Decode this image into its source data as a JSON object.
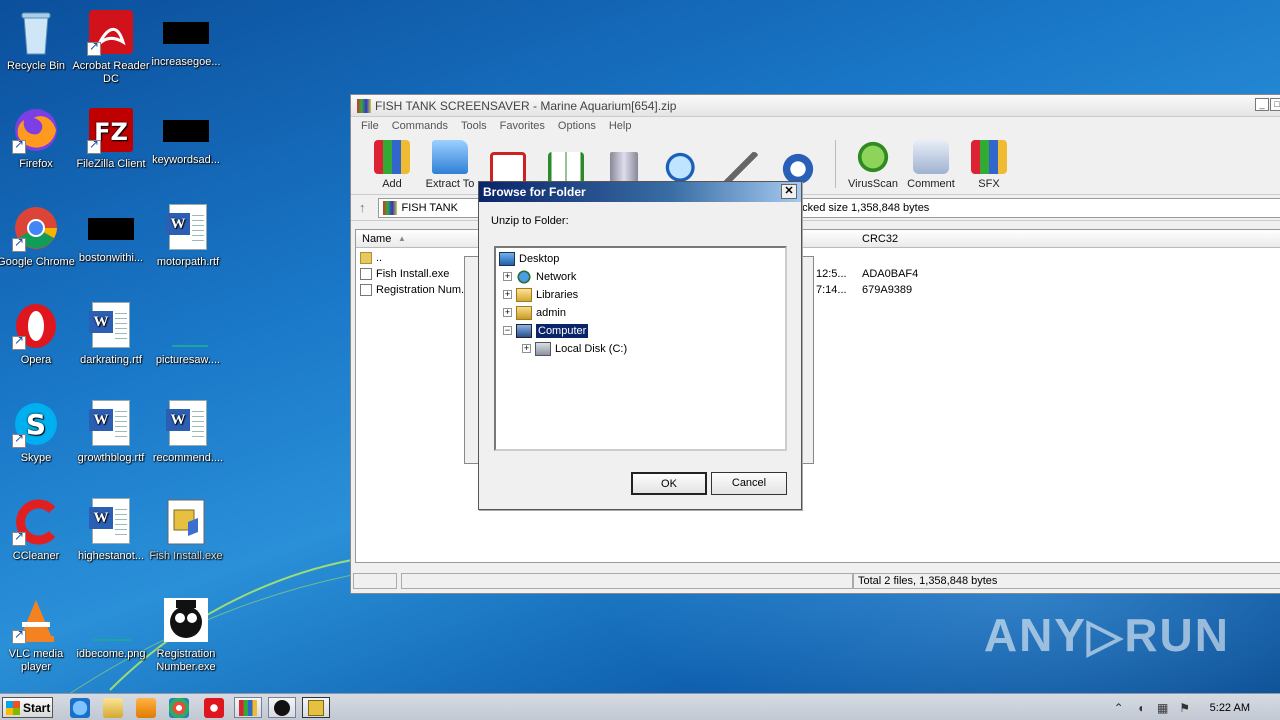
{
  "desktop": {
    "icons": [
      {
        "label": "Recycle Bin",
        "icon": "recycle-bin-icon"
      },
      {
        "label": "Acrobat Reader DC",
        "icon": "acrobat-icon"
      },
      {
        "label": "increasegoe...",
        "icon": "black-thumbnail-icon"
      },
      {
        "label": "Firefox",
        "icon": "firefox-icon"
      },
      {
        "label": "FileZilla Client",
        "icon": "filezilla-icon"
      },
      {
        "label": "keywordsad...",
        "icon": "black-thumbnail-icon"
      },
      {
        "label": "Google Chrome",
        "icon": "chrome-icon"
      },
      {
        "label": "bostonwithi...",
        "icon": "black-thumbnail-icon"
      },
      {
        "label": "motorpath.rtf",
        "icon": "word-doc-icon"
      },
      {
        "label": "Opera",
        "icon": "opera-icon"
      },
      {
        "label": "darkrating.rtf",
        "icon": "word-doc-icon"
      },
      {
        "label": "picturesaw....",
        "icon": "image-thumbnail-icon"
      },
      {
        "label": "Skype",
        "icon": "skype-icon"
      },
      {
        "label": "growthblog.rtf",
        "icon": "word-doc-icon"
      },
      {
        "label": "recommend....",
        "icon": "word-doc-icon"
      },
      {
        "label": "CCleaner",
        "icon": "ccleaner-icon"
      },
      {
        "label": "highestanot...",
        "icon": "word-doc-icon"
      },
      {
        "label": "Fish Install.exe",
        "icon": "installer-icon"
      },
      {
        "label": "VLC media player",
        "icon": "vlc-icon"
      },
      {
        "label": "idbecome.png",
        "icon": "image-thumbnail-icon"
      },
      {
        "label": "Registration Number.exe",
        "icon": "registration-exe-icon"
      }
    ]
  },
  "winrar": {
    "title": "FISH TANK SCREENSAVER - Marine Aquarium[654].zip",
    "menu": [
      "File",
      "Commands",
      "Tools",
      "Favorites",
      "Options",
      "Help"
    ],
    "toolbar": [
      {
        "label": "Add",
        "icon": "add-archive-icon"
      },
      {
        "label": "Extract To",
        "icon": "extract-folder-icon"
      },
      {
        "label": "",
        "icon": "test-clipboard-icon"
      },
      {
        "label": "",
        "icon": "view-book-icon"
      },
      {
        "label": "",
        "icon": "delete-trash-icon"
      },
      {
        "label": "",
        "icon": "find-magnifier-icon"
      },
      {
        "label": "",
        "icon": "wizard-wand-icon"
      },
      {
        "label": "",
        "icon": "info-icon"
      },
      {
        "label": "VirusScan",
        "icon": "virusscan-bug-icon"
      },
      {
        "label": "Comment",
        "icon": "comment-icon"
      },
      {
        "label": "SFX",
        "icon": "sfx-books-icon"
      }
    ],
    "address": {
      "prefix": "FISH TANK",
      "suffix": "acked size 1,358,848 bytes"
    },
    "columns": {
      "name": "Name",
      "crc": "CRC32"
    },
    "rows": [
      {
        "name": "..",
        "time": "",
        "crc": ""
      },
      {
        "name": "Fish Install.exe",
        "time": "12:5...",
        "crc": "ADA0BAF4"
      },
      {
        "name": "Registration Num...",
        "time": "7:14...",
        "crc": "679A9389"
      }
    ],
    "status": "Total 2 files, 1,358,848 bytes"
  },
  "dialog": {
    "title": "Browse for Folder",
    "close": "✕",
    "label": "Unzip to Folder:",
    "tree": [
      {
        "label": "Desktop",
        "icon": "desktop-icon",
        "expander": ""
      },
      {
        "label": "Network",
        "icon": "network-icon",
        "expander": "+"
      },
      {
        "label": "Libraries",
        "icon": "libraries-icon",
        "expander": "+"
      },
      {
        "label": "admin",
        "icon": "user-folder-icon",
        "expander": "+"
      },
      {
        "label": "Computer",
        "icon": "computer-icon",
        "expander": "−",
        "selected": true
      },
      {
        "label": "Local Disk (C:)",
        "icon": "local-disk-icon",
        "expander": "+"
      }
    ],
    "ok": "OK",
    "cancel": "Cancel"
  },
  "taskbar": {
    "start": "Start",
    "clock": "5:22 AM"
  },
  "watermark": "ANY▷RUN"
}
